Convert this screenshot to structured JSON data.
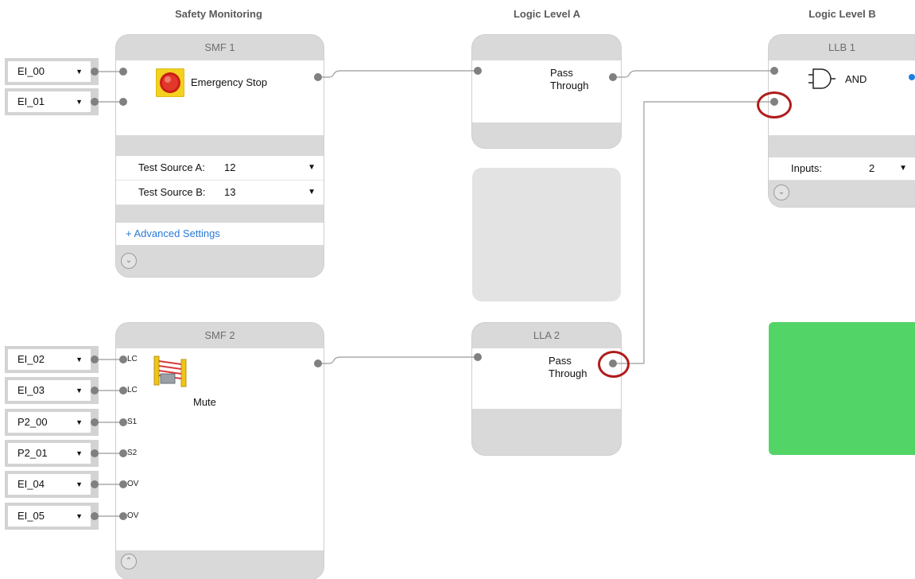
{
  "columns": {
    "safety": "Safety Monitoring",
    "logic_a": "Logic Level A",
    "logic_b": "Logic Level B"
  },
  "smf1": {
    "title": "SMF 1",
    "function": "Emergency Stop",
    "test_a_label": "Test Source A:",
    "test_a_value": "12",
    "test_b_label": "Test Source B:",
    "test_b_value": "13",
    "advanced": "+ Advanced Settings",
    "inputs": [
      "EI_00",
      "EI_01"
    ]
  },
  "smf2": {
    "title": "SMF 2",
    "function": "Mute",
    "inputs": [
      "EI_02",
      "EI_03",
      "P2_00",
      "P2_01",
      "EI_04",
      "EI_05"
    ],
    "port_labels": [
      "LC",
      "LC",
      "S1",
      "S2",
      "OV",
      "OV"
    ]
  },
  "lla1": {
    "title": "",
    "function_line1": "Pass",
    "function_line2": "Through"
  },
  "lla2": {
    "title": "LLA 2",
    "function_line1": "Pass",
    "function_line2": "Through"
  },
  "llb1": {
    "title": "LLB 1",
    "function": "AND",
    "inputs_label": "Inputs:",
    "inputs_value": "2"
  },
  "colors": {
    "status_green": "#52d467",
    "highlight_red": "#b01c1c",
    "link_blue": "#2a7ad6"
  }
}
